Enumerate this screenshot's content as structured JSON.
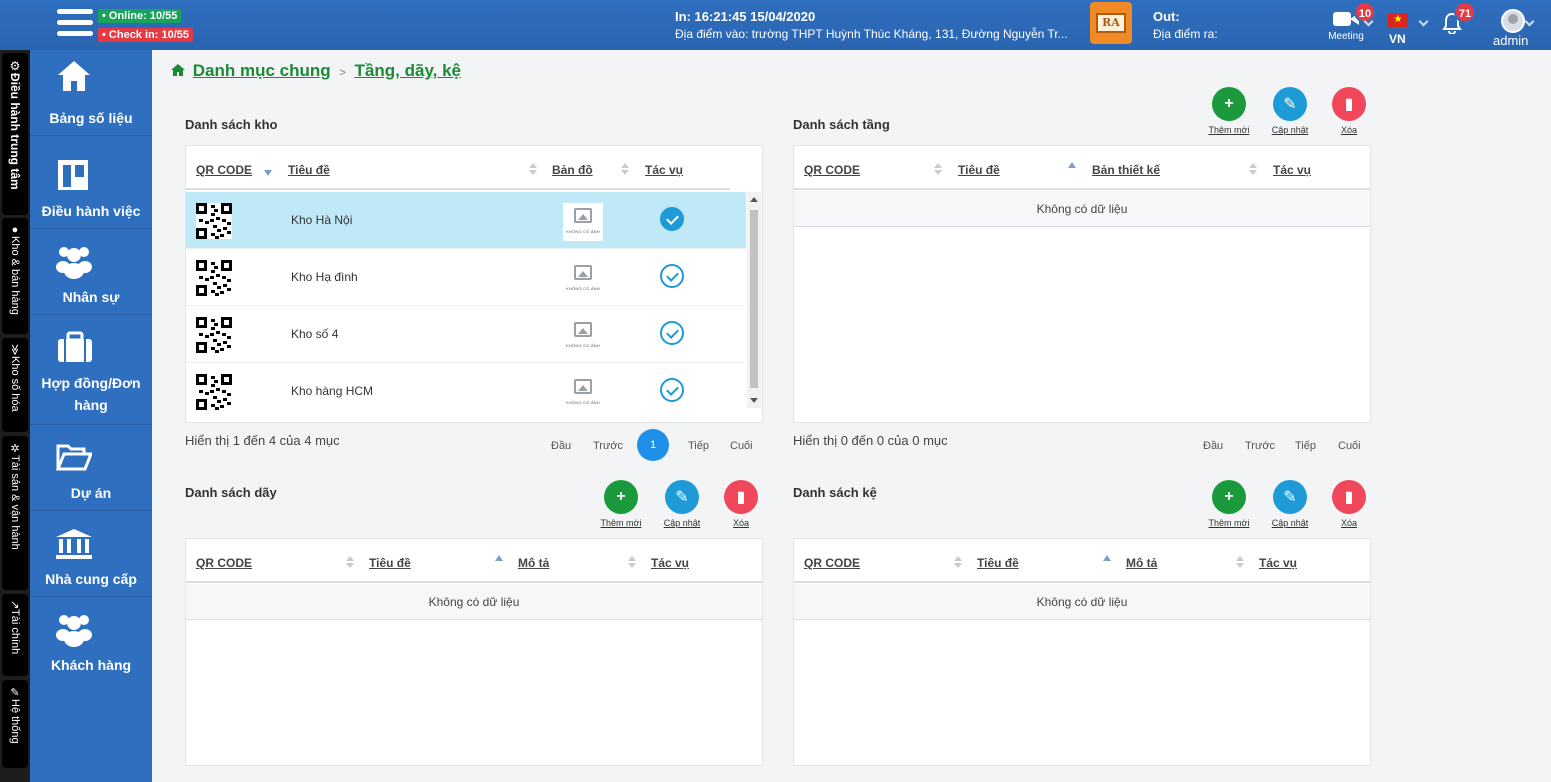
{
  "topbar": {
    "online": "• Online: 10/55",
    "checkin": "• Check in: 10/55",
    "in_time": "In: 16:21:45 15/04/2020",
    "in_place": "Địa điểm vào: trường THPT Huỳnh Thúc Kháng, 131, Đường Nguyễn Tr...",
    "ra_label": "RA",
    "out_label": "Out:",
    "out_place": "Địa điểm ra:",
    "meeting_label": "Meeting",
    "meeting_count": "10",
    "lang": "VN",
    "notif_count": "71",
    "user": "admin"
  },
  "vtabs": [
    "Điều hành trung tâm",
    "Kho & bán hàng",
    "Kho số hóa",
    "Tài sản & vận hành",
    "Tài chính",
    "Hệ thống"
  ],
  "sidebar": [
    "Bảng số liệu",
    "Điều hành việc",
    "Nhân sự",
    "Hợp đồng/Đơn hàng",
    "Dự án",
    "Nhà cung cấp",
    "Khách hàng"
  ],
  "breadcrumb": {
    "root": "Danh mục chung",
    "sep": ">",
    "current": "Tầng, dãy, kệ"
  },
  "actions": {
    "add": "Thêm mới",
    "update": "Cập nhật",
    "delete": "Xóa"
  },
  "kho": {
    "title": "Danh sách kho",
    "columns": [
      "QR CODE",
      "Tiêu đề",
      "Bản đồ",
      "Tác vụ"
    ],
    "rows": [
      {
        "name": "Kho Hà Nội",
        "map": "KHÔNG CÓ ẢNH"
      },
      {
        "name": "Kho Hạ đình",
        "map": "KHÔNG CÓ ẢNH"
      },
      {
        "name": "Kho số 4",
        "map": "KHÔNG CÓ ẢNH"
      },
      {
        "name": "Kho hàng HCM",
        "map": "KHÔNG CÓ ẢNH"
      }
    ],
    "info": "Hiển thị 1 đến 4 của 4 mục",
    "pager": {
      "first": "Đầu",
      "prev": "Trước",
      "current": "1",
      "next": "Tiếp",
      "last": "Cuối"
    }
  },
  "tang": {
    "title": "Danh sách tầng",
    "columns": [
      "QR CODE",
      "Tiêu đề",
      "Bản thiết kế",
      "Tác vụ"
    ],
    "empty": "Không có dữ liệu",
    "info": "Hiển thị 0 đến 0 của 0 mục",
    "pager": {
      "first": "Đầu",
      "prev": "Trước",
      "next": "Tiếp",
      "last": "Cuối"
    }
  },
  "day": {
    "title": "Danh sách dãy",
    "columns": [
      "QR CODE",
      "Tiêu đề",
      "Mô tả",
      "Tác vụ"
    ],
    "empty": "Không có dữ liệu"
  },
  "ke": {
    "title": "Danh sách kệ",
    "columns": [
      "QR CODE",
      "Tiêu đề",
      "Mô tả",
      "Tác vụ"
    ],
    "empty": "Không có dữ liệu"
  }
}
